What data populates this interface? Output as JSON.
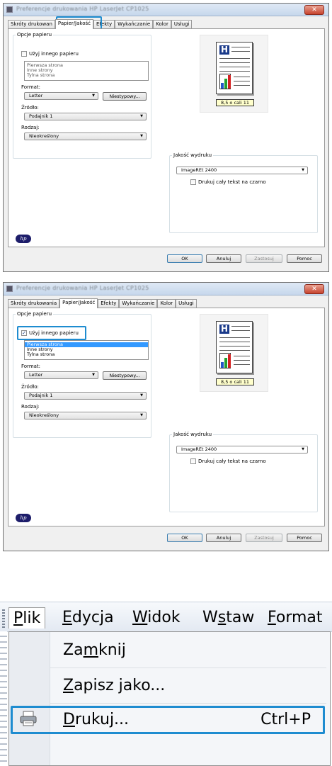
{
  "dialogs": [
    {
      "window_title": "Preferencje drukowania HP LaserJet CP1025",
      "tabs": [
        "Skróty drukowan",
        "Papier/Jakość",
        "Efekty",
        "Wykańczanie",
        "Kolor",
        "Usługi"
      ],
      "paper_options": {
        "group_label": "Opcje papieru",
        "use_different_paper": "Użyj innego papieru",
        "use_different_checked": false,
        "list_items": [
          "Pierwsza strona",
          "Inne strony",
          "Tylna strona"
        ],
        "format_label": "Format:",
        "format_value": "Letter",
        "custom_button": "Niestypowy...",
        "source_label": "Źródło:",
        "source_value": "Podajnik 1",
        "type_label": "Rodzaj:",
        "type_value": "Nieokreślony"
      },
      "preview": {
        "size_label": "8,5 o cali 11",
        "h_letter": "H"
      },
      "print_quality": {
        "group_label": "Jakość wydruku",
        "quality_value": "ImageREt 2400",
        "black_text": "Drukuj cały tekst na czarno"
      },
      "hp_logo": "hp",
      "buttons": {
        "ok": "OK",
        "cancel": "Anuluj",
        "apply": "Zastosuj",
        "help": "Pomoc"
      }
    },
    {
      "window_title": "Preferencje drukowania HP LaserJet CP1025",
      "tabs": [
        "Skróty drukowania",
        "Papier/Jakość",
        "Efekty",
        "Wykańczanie",
        "Kolor",
        "Usługi"
      ],
      "paper_options": {
        "group_label": "Opcje papieru",
        "use_different_paper": "Użyj innego papieru",
        "use_different_checked": true,
        "list_items": [
          "Pierwsza strona",
          "Inne strony",
          "Tylna strona"
        ],
        "format_label": "Format:",
        "format_value": "Letter",
        "custom_button": "Niestypowy...",
        "source_label": "Źródło:",
        "source_value": "Podajnik 1",
        "type_label": "Rodzaj:",
        "type_value": "Nieokreślony"
      },
      "preview": {
        "size_label": "8,5 o cali 11",
        "h_letter": "H"
      },
      "print_quality": {
        "group_label": "Jakość wydruku",
        "quality_value": "ImageREt 2400",
        "black_text": "Drukuj cały tekst na czarno"
      },
      "hp_logo": "hp",
      "buttons": {
        "ok": "OK",
        "cancel": "Anuluj",
        "apply": "Zastosuj",
        "help": "Pomoc"
      }
    }
  ],
  "menu": {
    "bar": [
      {
        "pre": "",
        "u": "P",
        "post": "lik"
      },
      {
        "pre": "",
        "u": "E",
        "post": "dycja"
      },
      {
        "pre": "",
        "u": "W",
        "post": "idok"
      },
      {
        "pre": "W",
        "u": "s",
        "post": "taw"
      },
      {
        "pre": "",
        "u": "F",
        "post": "ormat"
      }
    ],
    "items": [
      {
        "pre": "Za",
        "u": "m",
        "post": "knij",
        "shortcut": ""
      },
      {
        "pre": "",
        "u": "Z",
        "post": "apisz jako...",
        "shortcut": ""
      },
      {
        "pre": "",
        "u": "D",
        "post": "rukuj...",
        "shortcut": "Ctrl+P"
      }
    ]
  },
  "colors": {
    "highlight": "#1e8cd0",
    "hp_blue": "#1a3a8a",
    "selection": "#3399ff"
  }
}
